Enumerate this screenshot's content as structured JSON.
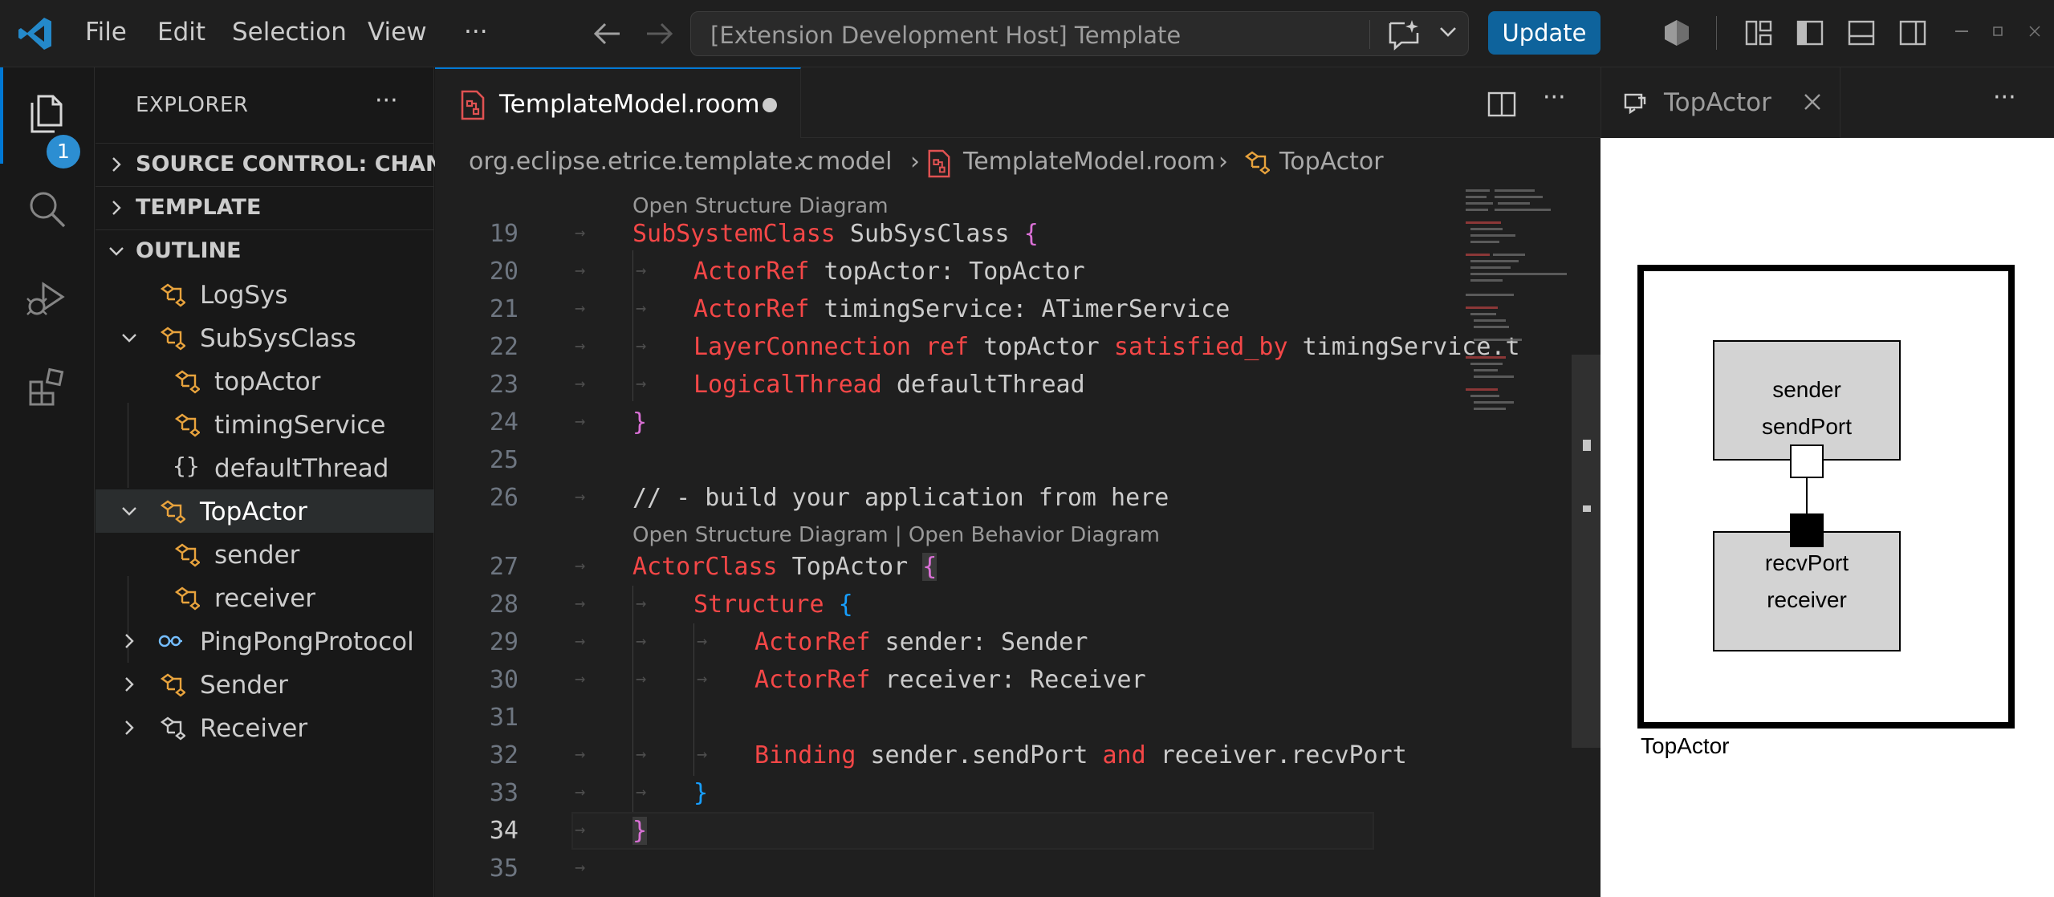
{
  "titlebar": {
    "menu": [
      "File",
      "Edit",
      "Selection",
      "View"
    ],
    "more": "···",
    "command_center": "[Extension Development Host] Template",
    "update_label": "Update"
  },
  "activity": {
    "badge": "1"
  },
  "sidebar": {
    "title": "EXPLORER",
    "more": "···",
    "sections": {
      "source_control": "SOURCE CONTROL: CHAN...",
      "template": "TEMPLATE",
      "outline": "OUTLINE"
    },
    "outline_items": [
      {
        "label": "LogSys",
        "icon": "class-icon"
      },
      {
        "label": "SubSysClass",
        "icon": "class-icon"
      },
      {
        "label": "topActor",
        "icon": "class-icon"
      },
      {
        "label": "timingService",
        "icon": "class-icon"
      },
      {
        "label": "defaultThread",
        "icon": "braces-icon"
      },
      {
        "label": "TopActor",
        "icon": "class-icon"
      },
      {
        "label": "sender",
        "icon": "class-icon"
      },
      {
        "label": "receiver",
        "icon": "class-icon"
      },
      {
        "label": "PingPongProtocol",
        "icon": "interface-icon"
      },
      {
        "label": "Sender",
        "icon": "class-icon"
      },
      {
        "label": "Receiver",
        "icon": "class-icon"
      }
    ]
  },
  "editor": {
    "tab_label": "TemplateModel.room",
    "breadcrumb": [
      "org.eclipse.etrice.template.c",
      "model",
      "TemplateModel.room",
      "TopActor"
    ],
    "codelens_1": "Open Structure Diagram",
    "codelens_2": "Open Structure Diagram | Open Behavior Diagram",
    "lines": {
      "19": {
        "num": "19",
        "kw": "SubSystemClass",
        "rest": " SubSysClass ",
        "punc": "{"
      },
      "20": {
        "num": "20",
        "kw": "ActorRef",
        "rest": " topActor: TopActor"
      },
      "21": {
        "num": "21",
        "kw": "ActorRef",
        "rest": " timingService: ATimerService"
      },
      "22": {
        "num": "22",
        "kw": "LayerConnection",
        "kw_b": "ref",
        "rest": " topActor ",
        "kw_c": "satisfied_by",
        "rest2": " timingService.t"
      },
      "23": {
        "num": "23",
        "kw": "LogicalThread",
        "rest": " defaultThread"
      },
      "24": {
        "num": "24",
        "punc": "}"
      },
      "25": {
        "num": "25"
      },
      "26": {
        "num": "26",
        "comment": "// - build your application from here"
      },
      "27": {
        "num": "27",
        "kw": "ActorClass",
        "rest": " TopActor ",
        "punc": "{"
      },
      "28": {
        "num": "28",
        "kw": "Structure",
        "punc": "{"
      },
      "29": {
        "num": "29",
        "kw": "ActorRef",
        "rest": " sender: Sender"
      },
      "30": {
        "num": "30",
        "kw": "ActorRef",
        "rest": " receiver: Receiver"
      },
      "31": {
        "num": "31"
      },
      "32": {
        "num": "32",
        "kw": "Binding",
        "rest": " sender.sendPort ",
        "kw_b": "and",
        "rest2": " receiver.recvPort"
      },
      "33": {
        "num": "33",
        "punc": "}"
      },
      "34": {
        "num": "34",
        "punc": "}"
      },
      "35": {
        "num": "35"
      }
    }
  },
  "right_panel": {
    "tab_label": "TopActor",
    "more": "···",
    "diagram": {
      "container_label": "TopActor",
      "sender_name": "sender",
      "sender_port": "sendPort",
      "receiver_port": "recvPort",
      "receiver_name": "receiver"
    }
  },
  "colors": {
    "accent": "#0078d4",
    "keyword": "#f44747",
    "bracket_magenta": "#da70d6",
    "bracket_blue": "#179fff",
    "outline_icon": "#e8a33d"
  }
}
